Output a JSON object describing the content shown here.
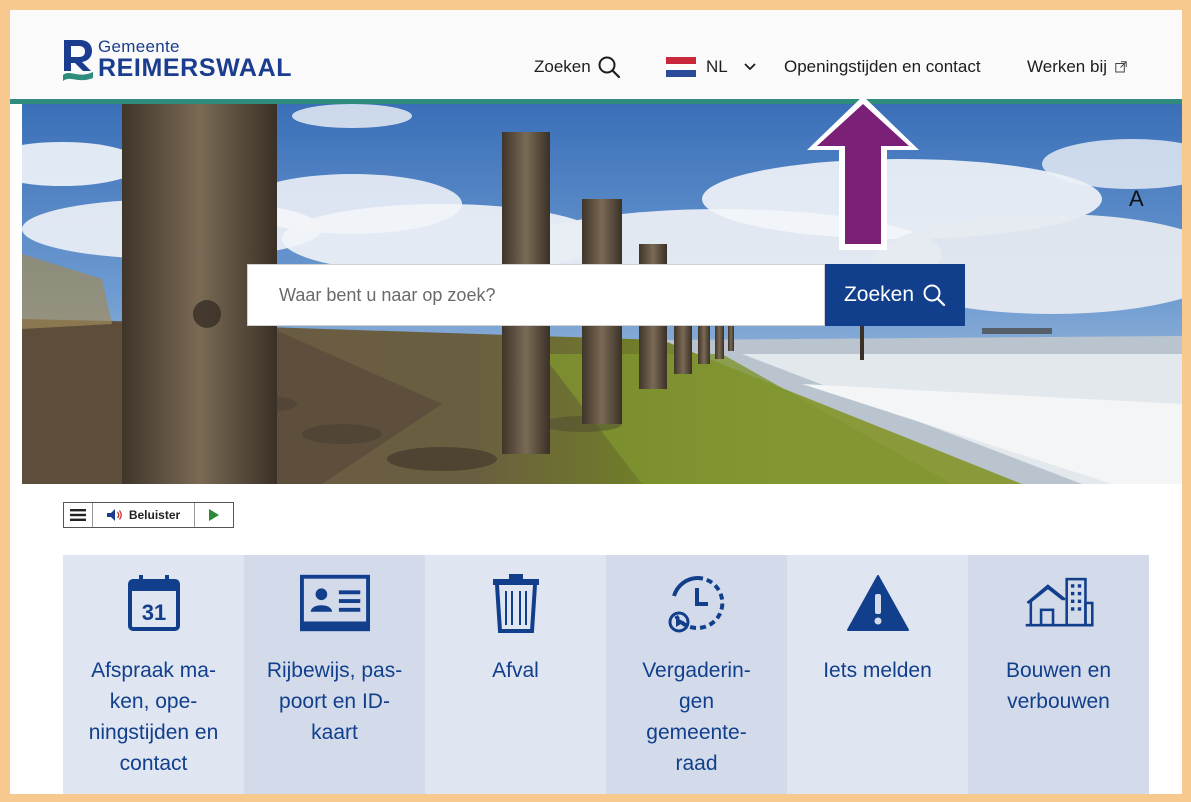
{
  "header": {
    "logo_top": "Gemeente",
    "logo_bottom": "REIMERSWAAL",
    "nav": {
      "search_label": "Zoeken",
      "language": "NL",
      "contact_label": "Openingstijden en contact",
      "werken_label": "Werken bij"
    }
  },
  "hero": {
    "search_placeholder": "Waar bent u naar op zoek?",
    "search_button_label": "Zoeken",
    "annotation_letter": "A"
  },
  "readspeaker": {
    "listen_label": "Beluister"
  },
  "tiles": [
    {
      "label": "Afspraak ma-\nken, ope-\nningstijden en\ncontact",
      "icon": "calendar-icon"
    },
    {
      "label": "Rijbewijs, pas-\npoort en ID-\nkaart",
      "icon": "id-card-icon"
    },
    {
      "label": "Afval",
      "icon": "trash-bin-icon"
    },
    {
      "label": "Vergaderin-\ngen\ngemeente-\nraad",
      "icon": "meeting-clock-icon"
    },
    {
      "label": "Iets melden",
      "icon": "warning-icon"
    },
    {
      "label": "Bouwen en\nverbouwen",
      "icon": "buildings-icon"
    }
  ],
  "colors": {
    "brand_blue": "#123f8c",
    "accent_green": "#2f8c7c",
    "frame_orange": "#f7c98f",
    "arrow_purple": "#7a2077"
  }
}
